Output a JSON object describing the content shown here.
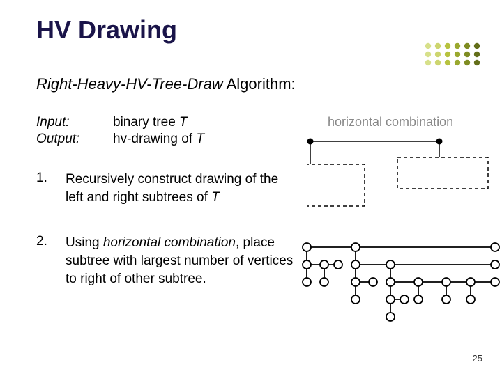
{
  "title": "HV Drawing",
  "subtitle_prefix": "Right-Heavy-HV-Tree-Draw",
  "subtitle_suffix": " Algorithm:",
  "io": {
    "input_label": "Input:",
    "input_value_prefix": "binary tree ",
    "input_value_var": "T",
    "output_label": "Output:",
    "output_value_prefix": "hv-drawing of ",
    "output_value_var": "T"
  },
  "steps": [
    {
      "num": "1.",
      "text_prefix": "Recursively construct drawing of the left and right subtrees of ",
      "text_var": "T"
    },
    {
      "num": "2.",
      "text_prefix": "Using ",
      "emph": "horizontal  combination",
      "text_suffix": ", place subtree with  largest number of vertices to right of other subtree."
    }
  ],
  "hc_label": "horizontal combination",
  "page_number": "25",
  "deco_colors": [
    "#d7e08a",
    "#cdd56f",
    "#b7c23f",
    "#9aa82e",
    "#7f8c22",
    "#636e19"
  ]
}
